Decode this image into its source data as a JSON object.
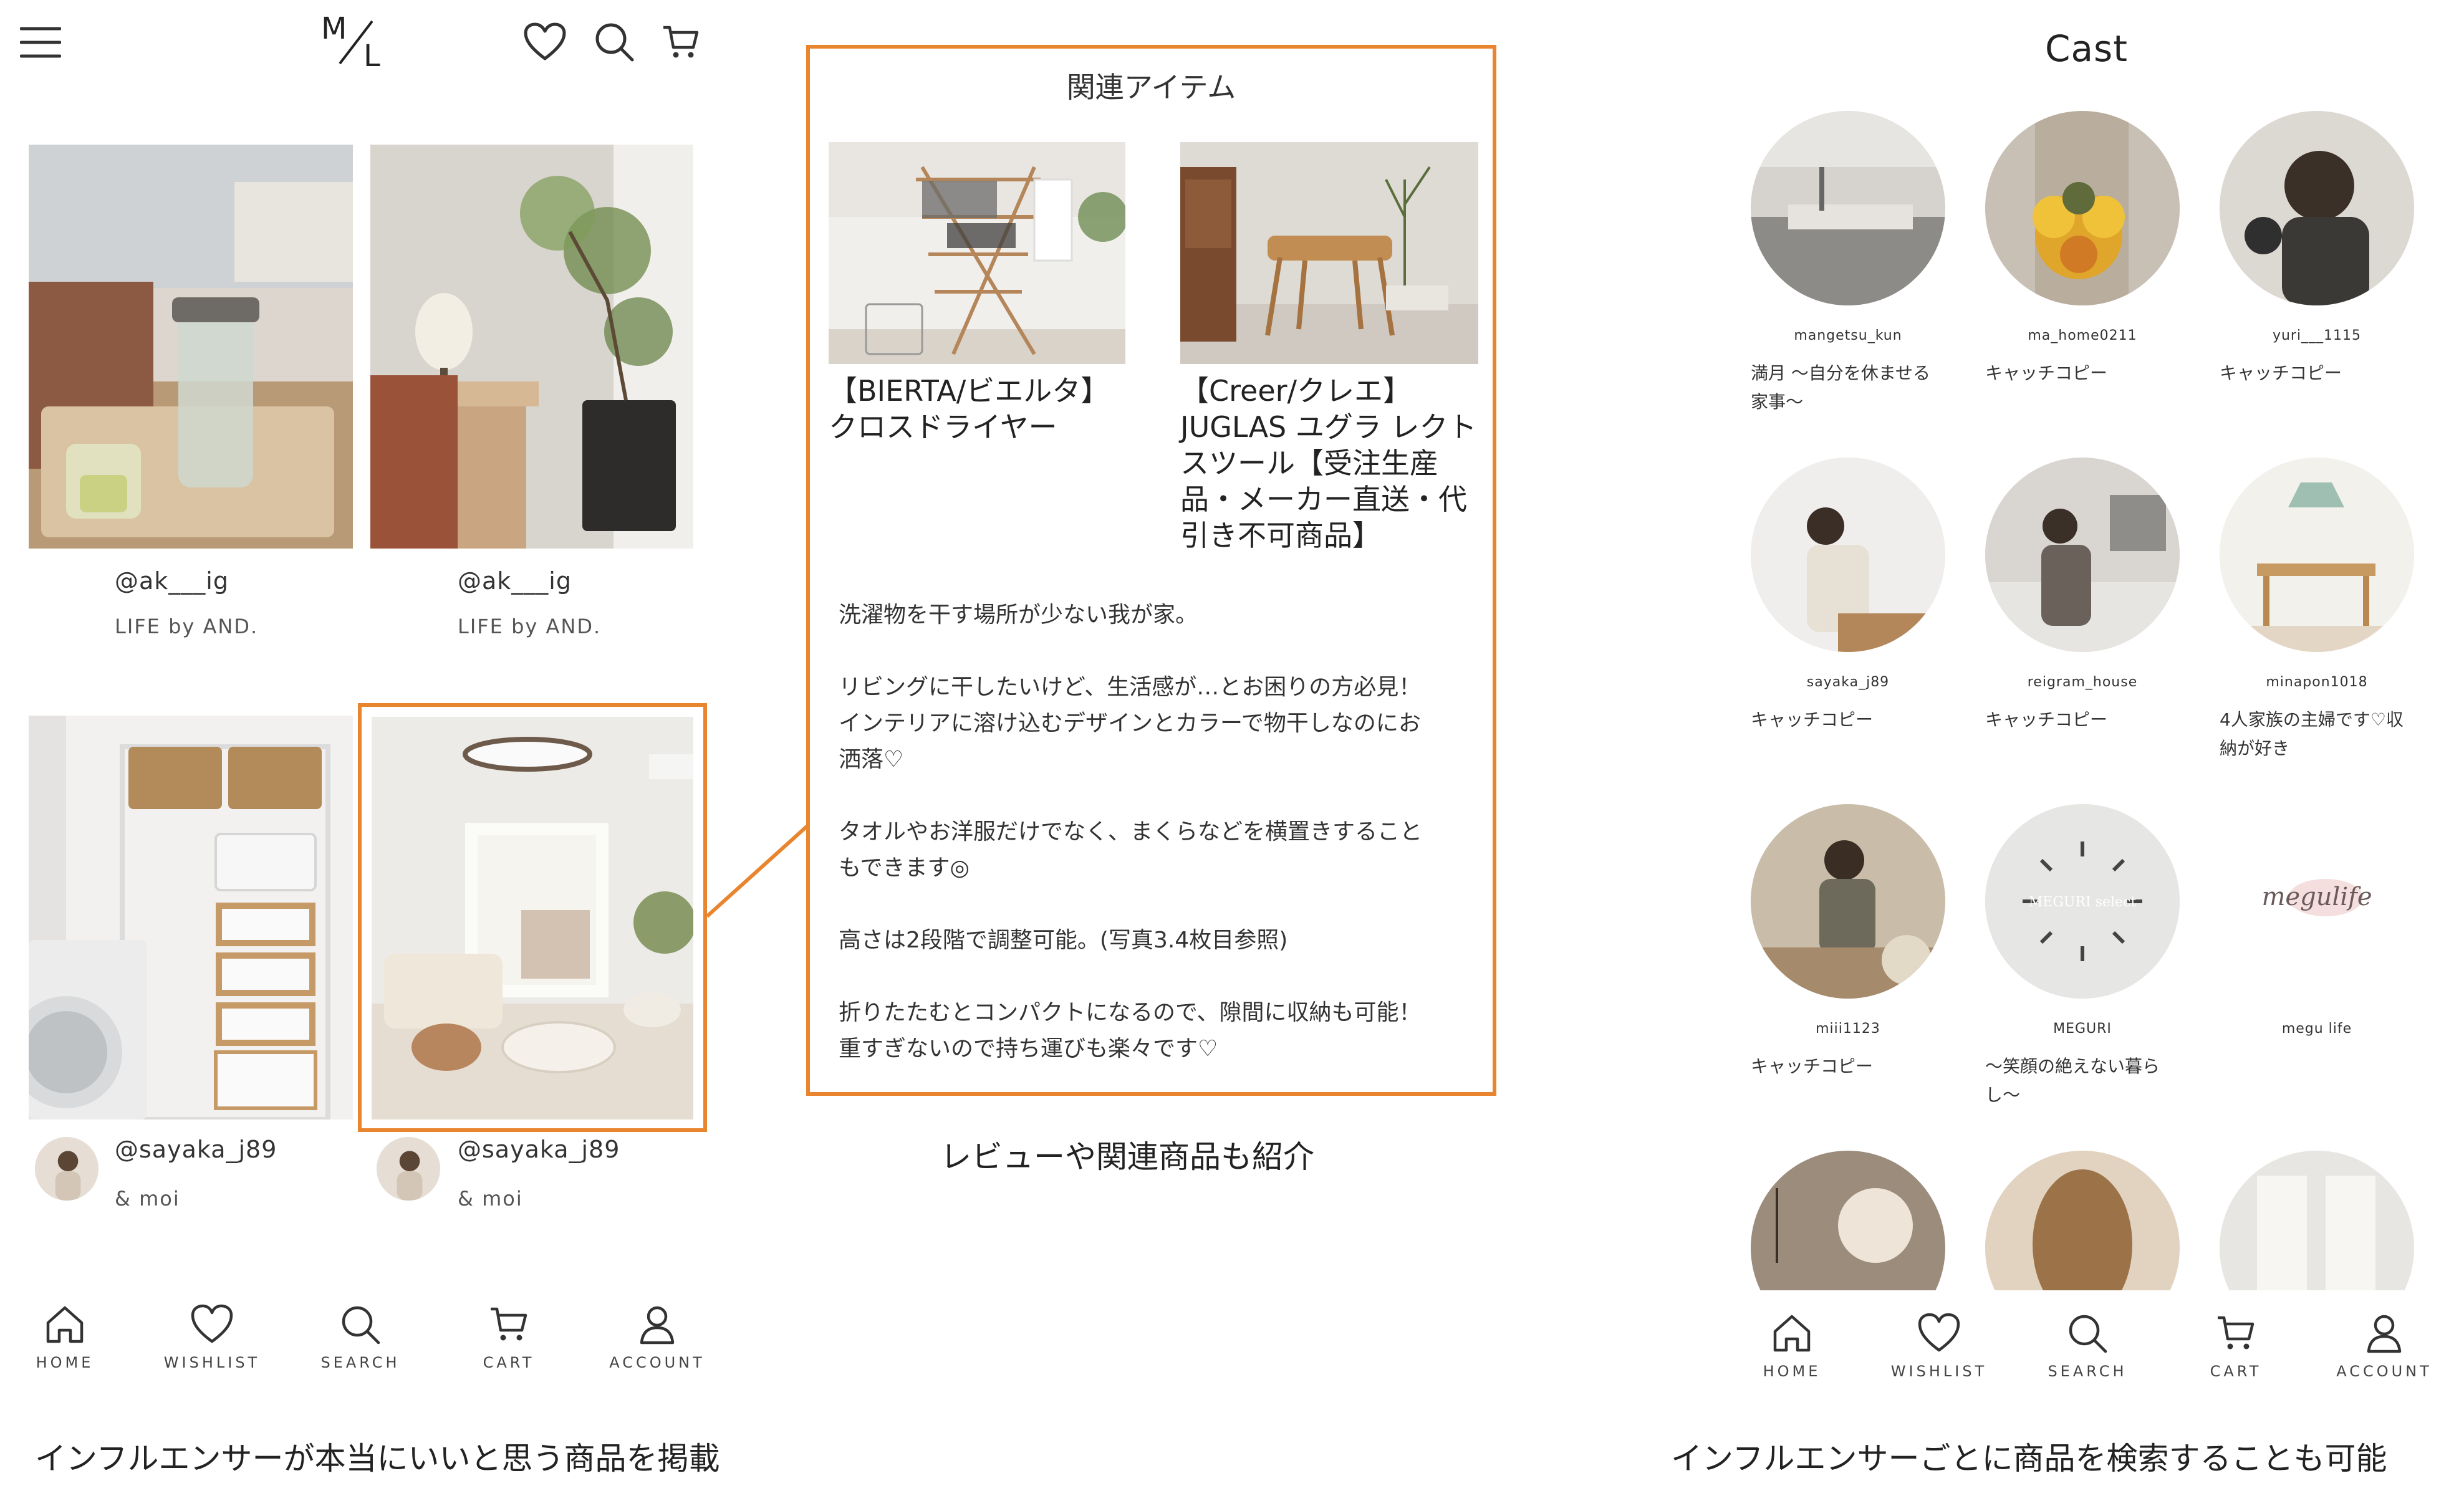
{
  "left_phone": {
    "logo": "M/L",
    "header_icons": [
      "menu-icon",
      "heart-icon",
      "search-icon",
      "cart-icon"
    ],
    "cards": [
      {
        "handle": "@ak___ig",
        "brand": "LIFE by AND."
      },
      {
        "handle": "@ak___ig",
        "brand": "LIFE by AND."
      },
      {
        "handle": "@sayaka_j89",
        "brand": "& moi"
      },
      {
        "handle": "@sayaka_j89",
        "brand": "& moi"
      }
    ],
    "nav": [
      {
        "label": "HOME",
        "icon": "home-icon"
      },
      {
        "label": "WISHLIST",
        "icon": "heart-icon"
      },
      {
        "label": "SEARCH",
        "icon": "search-icon"
      },
      {
        "label": "CART",
        "icon": "cart-icon"
      },
      {
        "label": "ACCOUNT",
        "icon": "account-icon"
      }
    ],
    "caption": "インフルエンサーが本当にいいと思う商品を掲載"
  },
  "popup": {
    "title": "関連アイテム",
    "products": [
      {
        "name_line1": "【BIERTA/ビエルタ】",
        "name_line2": "クロスドライヤー"
      },
      {
        "name_line1": "【Creer/クレエ】",
        "name_line2": "JUGLAS ユグラ レクト",
        "name_line3": "スツール【受注生産",
        "name_line4": "品・メーカー直送・代",
        "name_line5": "引き不可商品】"
      }
    ],
    "description": [
      "洗濯物を干す場所が少ない我が家。",
      "リビングに干したいけど、生活感が…とお困りの方必見！",
      "インテリアに溶け込むデザインとカラーで物干しなのにお",
      "洒落♡",
      "タオルやお洋服だけでなく、まくらなどを横置きすること",
      "もできます◎",
      "高さは2段階で調整可能。(写真3.4枚目参照)",
      "折りたたむとコンパクトになるので、隙間に収納も可能！",
      "重すぎないので持ち運びも楽々です♡"
    ],
    "caption": "レビューや関連商品も紹介",
    "accent_color": "#e9852e"
  },
  "right_phone": {
    "title": "Cast",
    "cast": [
      {
        "name": "mangetsu_kun",
        "copy_line1": "満月 〜自分を休ませる",
        "copy_line2": "家事〜"
      },
      {
        "name": "ma_home0211",
        "copy_line1": "キャッチコピー",
        "copy_line2": ""
      },
      {
        "name": "yuri___1115",
        "copy_line1": "キャッチコピー",
        "copy_line2": ""
      },
      {
        "name": "sayaka_j89",
        "copy_line1": "キャッチコピー",
        "copy_line2": ""
      },
      {
        "name": "reigram_house",
        "copy_line1": "キャッチコピー",
        "copy_line2": ""
      },
      {
        "name": "minapon1018",
        "copy_line1": "4人家族の主婦です♡収",
        "copy_line2": "納が好き"
      },
      {
        "name": "miii1123",
        "copy_line1": "キャッチコピー",
        "copy_line2": ""
      },
      {
        "name": "MEGURI",
        "copy_line1": "〜笑顔の絶えない暮ら",
        "copy_line2": "し〜"
      },
      {
        "name": "megu life",
        "copy_line1": "",
        "copy_line2": ""
      }
    ],
    "logo_texts": {
      "meguri": "MEGURI select",
      "megulife": "megulife"
    },
    "nav": [
      {
        "label": "HOME",
        "icon": "home-icon"
      },
      {
        "label": "WISHLIST",
        "icon": "heart-icon"
      },
      {
        "label": "SEARCH",
        "icon": "search-icon"
      },
      {
        "label": "CART",
        "icon": "cart-icon"
      },
      {
        "label": "ACCOUNT",
        "icon": "account-icon"
      }
    ],
    "caption": "インフルエンサーごとに商品を検索することも可能"
  }
}
